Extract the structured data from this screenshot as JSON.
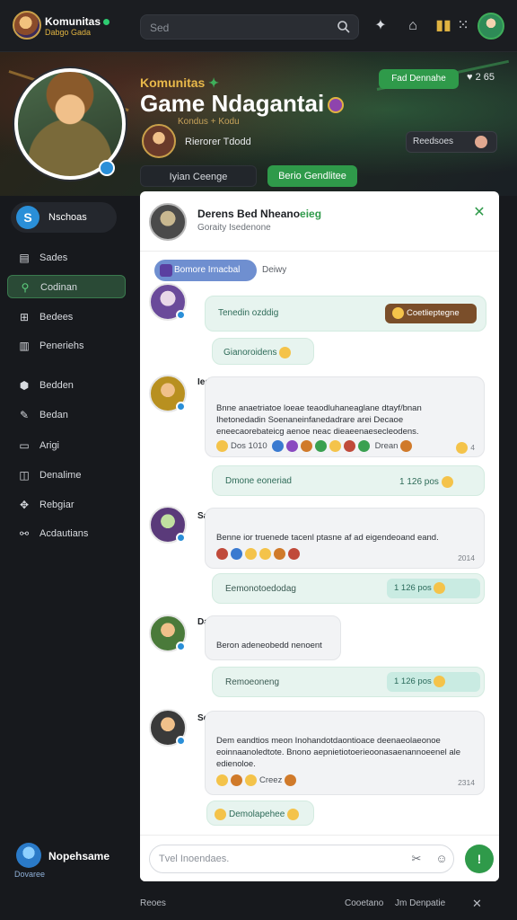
{
  "topbar": {
    "brand_title": "Komunitas",
    "brand_sub": "Dabgo Gada",
    "search_placeholder": "Sed",
    "icons": [
      "search-icon",
      "sparkle-icon",
      "gamepad-icon",
      "gift-icon",
      "grid-icon"
    ]
  },
  "hero": {
    "kicker": "Komunitas",
    "title": "Game Ndagantai",
    "subtitle": "Kondus + Kodu",
    "member_line": "Rierorer Tdodd",
    "top_button": "Fad Dennahe",
    "like_count": "2 65",
    "right_button": "Reedsoes",
    "tab1": "Iyian Ceenge",
    "tab2": "Berio Gendlitee"
  },
  "sidebar": {
    "home_label": "Nschoas",
    "items": [
      {
        "label": "Sades",
        "icon": "list-icon",
        "active": false
      },
      {
        "label": "Codinan",
        "icon": "search-icon",
        "active": true
      },
      {
        "label": "Bedees",
        "icon": "grid-icon",
        "active": false
      },
      {
        "label": "Peneriehs",
        "icon": "chart-icon",
        "active": false
      },
      {
        "label": "Bedden",
        "icon": "shield-icon",
        "active": false
      },
      {
        "label": "Bedan",
        "icon": "pin-icon",
        "active": false
      },
      {
        "label": "Arigi",
        "icon": "doc-icon",
        "active": false
      },
      {
        "label": "Denalime",
        "icon": "chat-icon",
        "active": false
      },
      {
        "label": "Rebgiar",
        "icon": "puzzle-icon",
        "active": false
      },
      {
        "label": "Acdautians",
        "icon": "link-icon",
        "active": false
      }
    ],
    "footer_title": "Nopehsame",
    "footer_sub": "Dovaree"
  },
  "chat": {
    "header_title": "Derens Bed Nheano",
    "header_title_green": "eieg",
    "header_sub": "Goraity Isedenone",
    "topic_pill": "Bomore Irnacbal",
    "topic_tag": "Deiwy",
    "messages": [
      {
        "name": "",
        "reply_text": "Tenedin ozddig",
        "reply_pill": "Coetlieptegne",
        "second_reply": "Gianoroidens"
      },
      {
        "name": "Iedorolet",
        "text": "Bnne anaetriatoe loeae teaodluhaneaglane dtayf/bnan Ihetonedadin Soenaneinfanedadrare arei Decaoe eneecaorebateicg aenoe neac dieaeenaesecleodens.",
        "reactions": "Dos 1010",
        "reactions_tail": "Drean",
        "reactions_count": "4",
        "reply_text": "Dmone eoneriad",
        "reply_time": "1 126 pos"
      },
      {
        "name": "Saenrpe",
        "text": "Benne ior truenede tacenl ptasne af ad eigendeoand eand.",
        "time": "2014",
        "reply_text": "Eemonotoedodag",
        "reply_time": "1 126 pos"
      },
      {
        "name": "Dasorogh",
        "text": "Beron adeneobedd nenoent",
        "reply_text": "Remoeoneng",
        "reply_time": "1 126 pos"
      },
      {
        "name": "Semeoee",
        "text": "Dem eandtios meon Inohandotdaontioace deenaeolaeonoe eoinnaanoledtote. Bnono aepnietiotoerieoonasaenannoeenel ale edienoloe.",
        "reactions": "Creez",
        "time": "2314",
        "reply_text": "Demolapehee"
      }
    ],
    "composer_placeholder": "Tvel Inoendaes.",
    "send_label": "!"
  },
  "bottombar": {
    "left": "Reoes",
    "right1": "Cooetano",
    "right2": "Jm Denpatie"
  }
}
